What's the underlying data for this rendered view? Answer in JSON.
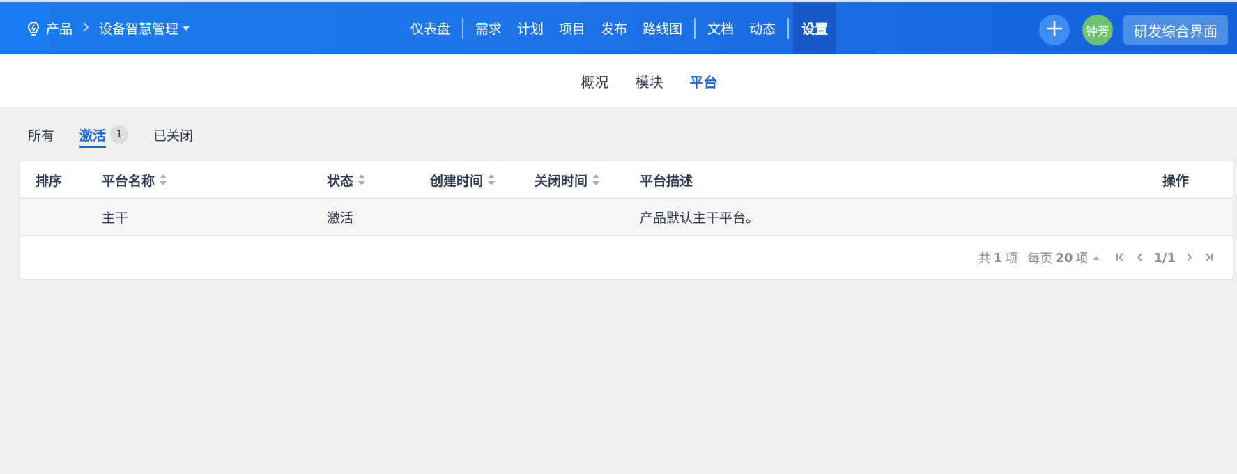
{
  "header": {
    "breadcrumb": {
      "product_label": "产品",
      "current": "设备智慧管理"
    },
    "nav": [
      {
        "label": "仪表盘"
      },
      {
        "label": "需求"
      },
      {
        "label": "计划"
      },
      {
        "label": "项目"
      },
      {
        "label": "发布"
      },
      {
        "label": "路线图"
      },
      {
        "label": "文档"
      },
      {
        "label": "动态"
      },
      {
        "label": "设置"
      }
    ],
    "active_nav": "设置",
    "avatar_text": "钟芳",
    "switch_button": "研发综合界面"
  },
  "subnav": [
    {
      "label": "概况"
    },
    {
      "label": "模块"
    },
    {
      "label": "平台"
    }
  ],
  "active_subnav": "平台",
  "tabs": [
    {
      "label": "所有"
    },
    {
      "label": "激活",
      "count": "1"
    },
    {
      "label": "已关闭"
    }
  ],
  "active_tab": "激活",
  "table": {
    "columns": [
      {
        "label": "排序",
        "sortable": false
      },
      {
        "label": "平台名称",
        "sortable": true
      },
      {
        "label": "状态",
        "sortable": true
      },
      {
        "label": "创建时间",
        "sortable": true
      },
      {
        "label": "关闭时间",
        "sortable": true
      },
      {
        "label": "平台描述",
        "sortable": false
      },
      {
        "label": "操作",
        "sortable": false
      }
    ],
    "rows": [
      {
        "order": "",
        "name": "主干",
        "status": "激活",
        "created": "",
        "closed": "",
        "description": "产品默认主干平台。",
        "actions": ""
      }
    ]
  },
  "pager": {
    "total_prefix": "共",
    "total": "1",
    "total_suffix": "项",
    "per_page_prefix": "每页",
    "per_page": "20",
    "per_page_suffix": "项",
    "page": "1/1"
  },
  "colors": {
    "brand": "#1a7cf2",
    "active_text": "#1565e0",
    "avatar": "#6bc26f"
  }
}
